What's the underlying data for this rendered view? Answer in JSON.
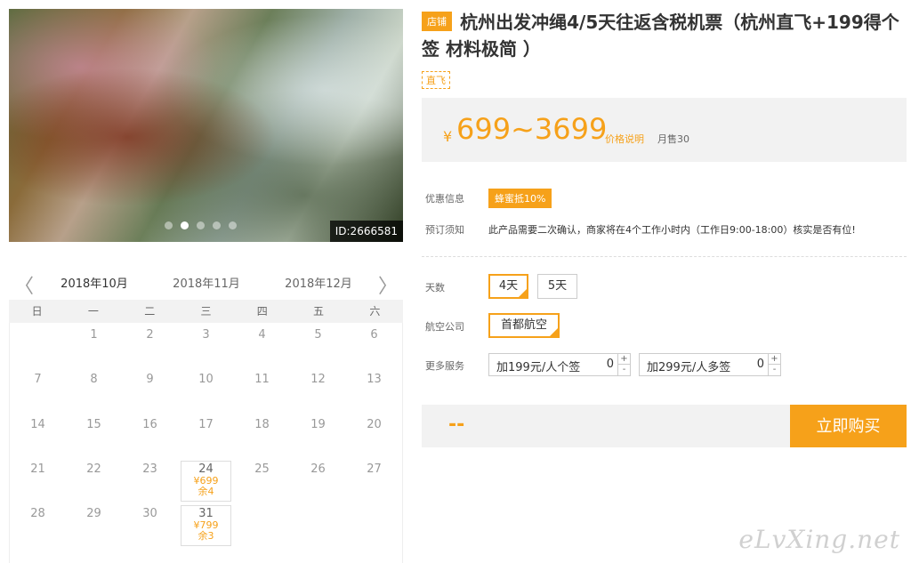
{
  "gallery": {
    "id_badge": "ID:2666581",
    "dots": [
      false,
      true,
      false,
      false,
      false
    ]
  },
  "product": {
    "shop_tag": "店铺",
    "title": "杭州出发冲绳4/5天往返含税机票（杭州直飞+199得个签 材料极简 ）",
    "direct_tag": "直飞",
    "price_yen": "¥",
    "price_range": "699~3699",
    "price_explain": "价格说明",
    "monthly_sales": "月售30"
  },
  "promo": {
    "label": "优惠信息",
    "tag": "蜂蜜抵10%"
  },
  "notice": {
    "label": "预订须知",
    "text": "此产品需要二次确认，商家将在4个工作小时内（工作日9:00-18:00）核实是否有位!"
  },
  "days": {
    "label": "天数",
    "options": [
      {
        "label": "4天",
        "selected": true
      },
      {
        "label": "5天",
        "selected": false
      }
    ]
  },
  "airline": {
    "label": "航空公司",
    "options": [
      {
        "label": "首都航空",
        "selected": true
      }
    ]
  },
  "services": {
    "label": "更多服务",
    "items": [
      {
        "label": "加199元/人个签",
        "qty": "0",
        "plus": "+",
        "minus": "-"
      },
      {
        "label": "加299元/人多签",
        "qty": "0",
        "plus": "+",
        "minus": "-"
      }
    ]
  },
  "purchase": {
    "total": "--",
    "buy_label": "立即购买"
  },
  "calendar": {
    "prev": "〈",
    "next": "〉",
    "months": [
      "2018年10月",
      "2018年11月",
      "2018年12月"
    ],
    "weekdays": [
      "日",
      "一",
      "二",
      "三",
      "四",
      "五",
      "六"
    ],
    "days": [
      "",
      "1",
      "2",
      "3",
      "4",
      "5",
      "6",
      "7",
      "8",
      "9",
      "10",
      "11",
      "12",
      "13",
      "14",
      "15",
      "16",
      "17",
      "18",
      "19",
      "20",
      "21",
      "22",
      "23",
      "24",
      "25",
      "26",
      "27",
      "28",
      "29",
      "30",
      "31",
      "",
      "",
      ""
    ],
    "prices": {
      "24": {
        "price": "¥699",
        "remain": "余4"
      },
      "31": {
        "price": "¥799",
        "remain": "余3"
      }
    }
  },
  "watermark": "eLvXing.net",
  "colors": {
    "accent": "#f6a11a",
    "panel": "#f2f2f2"
  }
}
